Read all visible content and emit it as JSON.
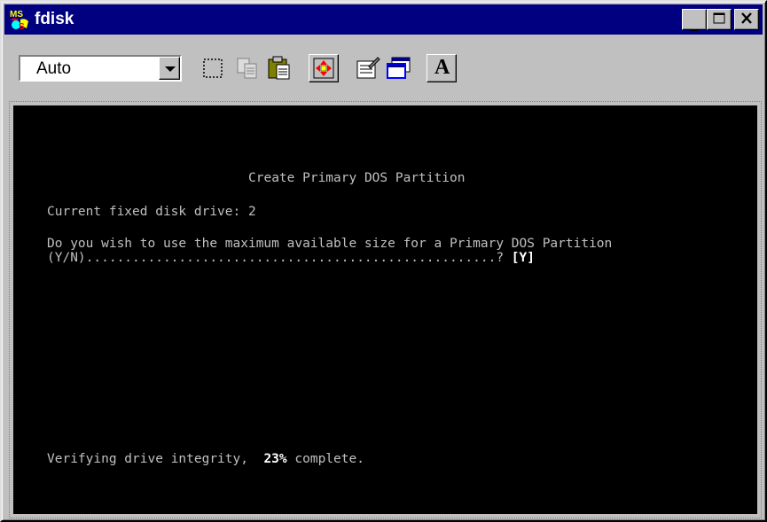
{
  "window": {
    "title": "fdisk",
    "app_icon": "ms-dos-icon",
    "caption_buttons": [
      {
        "name": "minimize-button",
        "glyph": "_"
      },
      {
        "name": "maximize-button",
        "glyph": "□"
      },
      {
        "name": "close-button",
        "glyph": "✕"
      }
    ]
  },
  "toolbar": {
    "font_size_value": "Auto",
    "buttons": [
      {
        "name": "mark-button",
        "icon": "mark-icon"
      },
      {
        "name": "copy-button",
        "icon": "copy-icon"
      },
      {
        "name": "paste-button",
        "icon": "paste-icon"
      },
      {
        "name": "full-screen-button",
        "icon": "full-screen-icon"
      },
      {
        "name": "properties-button",
        "icon": "properties-icon"
      },
      {
        "name": "background-button",
        "icon": "background-icon"
      },
      {
        "name": "font-button",
        "icon": "font-icon"
      }
    ],
    "font_button_glyph": "A"
  },
  "console": {
    "heading": "Create Primary DOS Partition",
    "drive_line": "Current fixed disk drive: 2",
    "question_line": "Do you wish to use the maximum available size for a Primary DOS Partition",
    "answer_prompt": "(Y/N).....................................................?",
    "answer_value": "[Y]",
    "status_prefix": "Verifying drive integrity,",
    "progress_percent": "23%",
    "status_suffix": "complete."
  },
  "colors": {
    "titlebar": "#000080",
    "console_background": "#000000",
    "console_text": "#c0c0c0",
    "console_bright_text": "#ffffff",
    "window_face": "#c0c0c0"
  }
}
